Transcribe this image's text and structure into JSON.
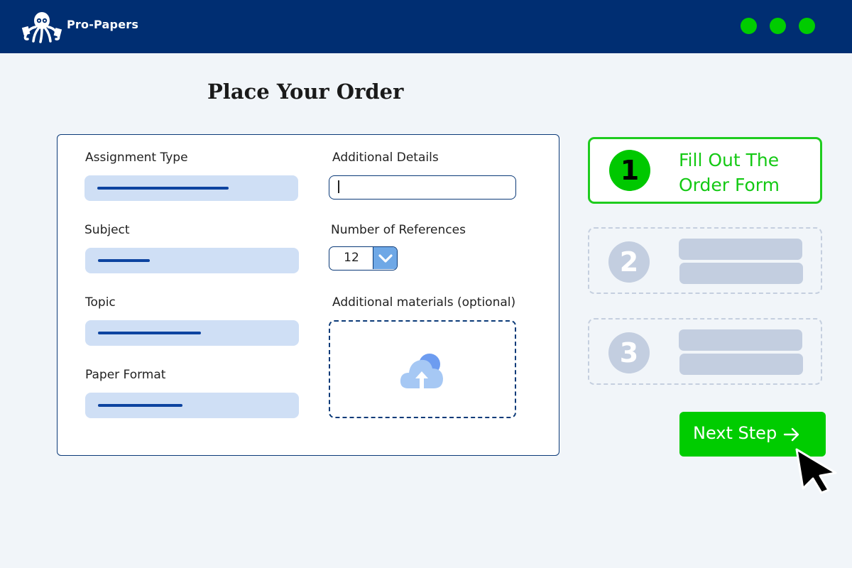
{
  "header": {
    "brand": "Pro-Papers",
    "logo_icon": "octopus-logo-icon",
    "window_dots": [
      "#00cc00",
      "#00cc00",
      "#00cc00"
    ]
  },
  "page": {
    "title": "Place Your Order"
  },
  "form": {
    "assignment_type_label": "Assignment Type",
    "subject_label": "Subject",
    "topic_label": "Topic",
    "paper_format_label": "Paper Format",
    "additional_details_label": "Additional Details",
    "additional_details_value": "",
    "references_label": "Number of References",
    "references_value": "12",
    "materials_label": "Additional materials (optional)",
    "upload_icon": "cloud-upload-icon",
    "dropdown_icon": "chevron-down-icon"
  },
  "steps": [
    {
      "number": "1",
      "label_line1": "Fill Out The",
      "label_line2": "Order Form",
      "active": true
    },
    {
      "number": "2",
      "active": false
    },
    {
      "number": "3",
      "active": false
    }
  ],
  "actions": {
    "next_label": "Next Step",
    "next_icon": "arrow-right-icon"
  },
  "colors": {
    "header_bg": "#002e72",
    "accent_green": "#00cc00",
    "border_navy": "#0b3a78",
    "pill_fill": "#cfdff5",
    "placeholder_gray": "#c3cee0"
  }
}
